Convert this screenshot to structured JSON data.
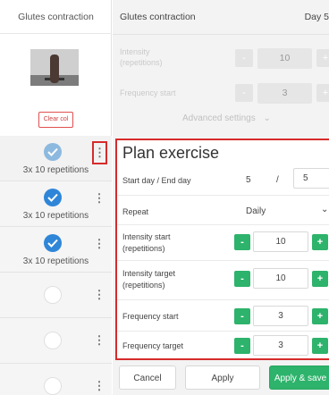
{
  "left": {
    "title": "Glutes contraction",
    "clear_label": "Clear col",
    "rows": [
      {
        "label": "3x 10 repetitions",
        "state": "checked-light"
      },
      {
        "label": "3x 10 repetitions",
        "state": "checked"
      },
      {
        "label": "3x 10 repetitions",
        "state": "checked"
      },
      {
        "label": "",
        "state": "empty"
      },
      {
        "label": "",
        "state": "empty"
      },
      {
        "label": "",
        "state": "empty"
      }
    ]
  },
  "right": {
    "title": "Glutes contraction",
    "day_label": "Day 5",
    "ghost": {
      "intensity_label": "Intensity (repetitions)",
      "intensity_value": "10",
      "frequency_label": "Frequency start",
      "frequency_value": "3",
      "minus": "-",
      "plus": "+"
    },
    "advanced_settings": "Advanced settings",
    "plan": {
      "heading": "Plan exercise",
      "start_end_label": "Start day / End day",
      "start_day": "5",
      "slash": "/",
      "end_day": "5",
      "repeat_label": "Repeat",
      "repeat_value": "Daily",
      "intensity_start_label": "Intensity start (repetitions)",
      "intensity_start_value": "10",
      "intensity_target_label": "Intensity target (repetitions)",
      "intensity_target_value": "10",
      "frequency_start_label": "Frequency start",
      "frequency_start_value": "3",
      "frequency_target_label": "Frequency target",
      "frequency_target_value": "3",
      "minus": "-",
      "plus": "+"
    },
    "buttons": {
      "cancel": "Cancel",
      "apply": "Apply",
      "apply_save": "Apply & save"
    }
  },
  "colors": {
    "accent_green": "#2db36b",
    "highlight_red": "#d62b2b",
    "check_blue": "#2f86d8"
  }
}
